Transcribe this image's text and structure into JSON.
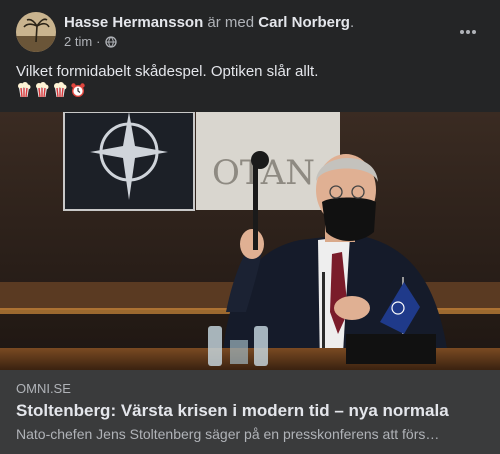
{
  "post": {
    "author": "Hasse Hermansson",
    "with_text": "är med",
    "tagged": "Carl Norberg",
    "tagged_suffix": ".",
    "time": "2 tim",
    "separator": "·",
    "audience_icon": "globe-icon",
    "text": "Vilket formidabelt skådespel. Optiken slår allt.",
    "emojis": [
      "popcorn-icon",
      "popcorn-icon",
      "popcorn-icon",
      "alarm-clock-icon"
    ]
  },
  "link_preview": {
    "domain": "OMNI.SE",
    "headline": "Stoltenberg: Värsta krisen i modern tid – nya normala",
    "description": "Nato-chefen Jens Stoltenberg säger på en presskonferens att förs…",
    "image_text": "OTAN"
  },
  "colors": {
    "background": "#242526",
    "link_box": "#3a3b3c",
    "primary_text": "#e4e6eb",
    "secondary_text": "#b0b3b8"
  }
}
